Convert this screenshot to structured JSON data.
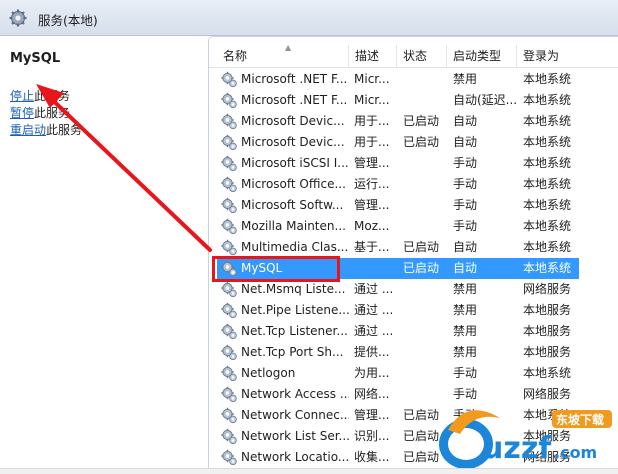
{
  "window": {
    "title": "服务(本地)"
  },
  "left": {
    "service_name": "MySQL",
    "actions": [
      {
        "link": "停止",
        "rest": "此服务"
      },
      {
        "link": "暂停",
        "rest": "此服务"
      },
      {
        "link": "重启动",
        "rest": "此服务"
      }
    ]
  },
  "table": {
    "columns": [
      "名称",
      "描述",
      "状态",
      "启动类型",
      "登录为"
    ],
    "rows": [
      [
        "Microsoft .NET F...",
        "Micr...",
        "",
        "禁用",
        "本地系统"
      ],
      [
        "Microsoft .NET F...",
        "Micr...",
        "",
        "自动(延迟...",
        "本地系统"
      ],
      [
        "Microsoft Devic...",
        "用于...",
        "已启动",
        "自动",
        "本地系统"
      ],
      [
        "Microsoft Devic...",
        "用于...",
        "已启动",
        "自动",
        "本地系统"
      ],
      [
        "Microsoft iSCSI I...",
        "管理...",
        "",
        "手动",
        "本地系统"
      ],
      [
        "Microsoft Office...",
        "运行...",
        "",
        "手动",
        "本地系统"
      ],
      [
        "Microsoft Softw...",
        "管理...",
        "",
        "手动",
        "本地系统"
      ],
      [
        "Mozilla Mainten...",
        "Moz...",
        "",
        "手动",
        "本地系统"
      ],
      [
        "Multimedia Clas...",
        "基于...",
        "已启动",
        "自动",
        "本地系统"
      ],
      [
        "MySQL",
        "",
        "已启动",
        "自动",
        "本地系统"
      ],
      [
        "Net.Msmq Liste...",
        "通过 ...",
        "",
        "禁用",
        "网络服务"
      ],
      [
        "Net.Pipe Listene...",
        "通过 ...",
        "",
        "禁用",
        "本地服务"
      ],
      [
        "Net.Tcp Listener...",
        "通过 ...",
        "",
        "禁用",
        "本地服务"
      ],
      [
        "Net.Tcp Port Sh...",
        "提供...",
        "",
        "禁用",
        "本地服务"
      ],
      [
        "Netlogon",
        "为用...",
        "",
        "手动",
        "本地系统"
      ],
      [
        "Network Access ...",
        "网络...",
        "",
        "手动",
        "网络服务"
      ],
      [
        "Network Connec...",
        "管理...",
        "已启动",
        "手动",
        "本地系统"
      ],
      [
        "Network List Ser...",
        "识别...",
        "已启动",
        "手动",
        "本地服务"
      ],
      [
        "Network Locatio...",
        "收集...",
        "已启动",
        "自动",
        "网络服务"
      ]
    ],
    "selected_row_index": 9
  },
  "watermark": {
    "brand": "uzzf.com",
    "badge": "东坡下载"
  },
  "colors": {
    "selection": "#3399ff",
    "annotation": "#e8151b",
    "link": "#1a5fbf"
  },
  "icons": {
    "window": "gear-icon",
    "row": "service-gear-icon"
  }
}
